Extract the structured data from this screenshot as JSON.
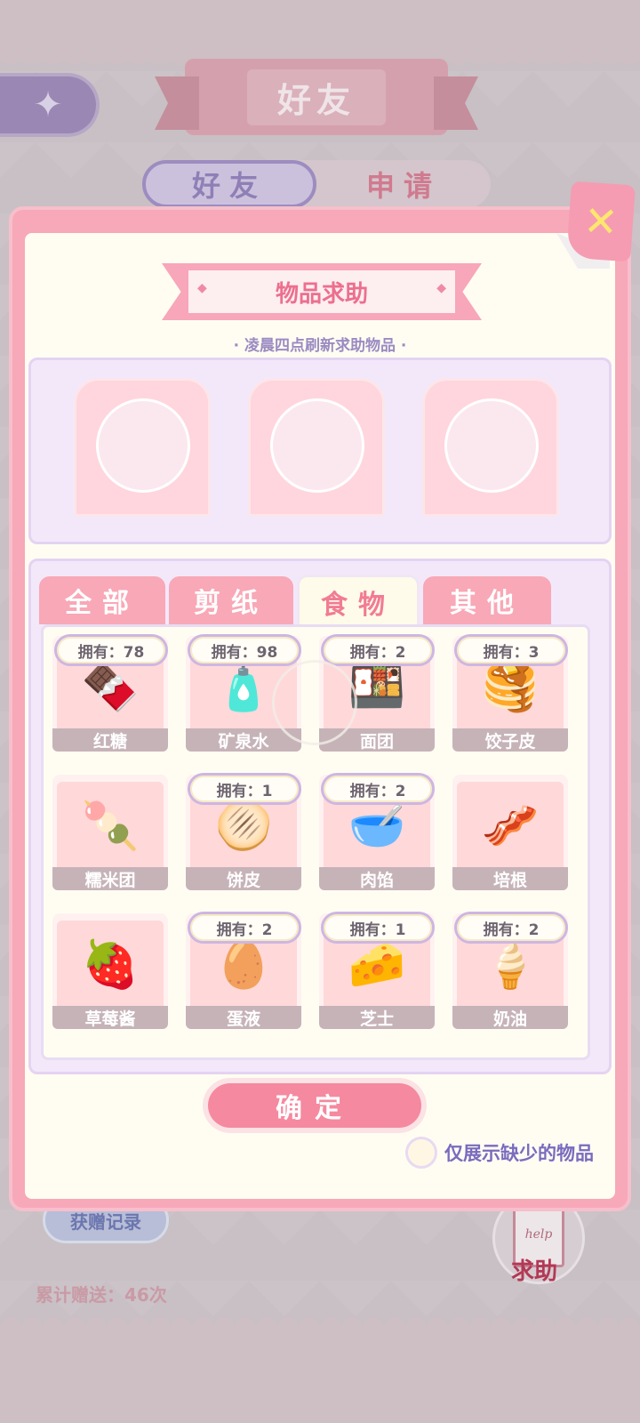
{
  "header": {
    "title": "好友",
    "back_icon": "compass-star-icon"
  },
  "bg_tabs": {
    "friend": "好友",
    "apply": "申请"
  },
  "dialog": {
    "section_title": "物品求助",
    "refresh_hint": "· 凌晨四点刷新求助物品 ·",
    "close_icon": "close-x-icon",
    "tabs": [
      "全部",
      "剪纸",
      "食物",
      "其他"
    ],
    "active_tab": "食物",
    "items": [
      {
        "name": "红糖",
        "owned": "拥有：78",
        "icon": "brown-sugar-bag"
      },
      {
        "name": "矿泉水",
        "owned": "拥有：98",
        "icon": "water-bottle"
      },
      {
        "name": "面团",
        "owned": "拥有：2",
        "icon": "dough-box"
      },
      {
        "name": "饺子皮",
        "owned": "拥有：3",
        "icon": "dumpling-wrappers"
      },
      {
        "name": "糯米团",
        "owned": "",
        "icon": "rice-balls-bowl"
      },
      {
        "name": "饼皮",
        "owned": "拥有：1",
        "icon": "pastry-sheet"
      },
      {
        "name": "肉馅",
        "owned": "拥有：2",
        "icon": "meat-filling-bowl"
      },
      {
        "name": "培根",
        "owned": "",
        "icon": "bacon"
      },
      {
        "name": "草莓酱",
        "owned": "",
        "icon": "strawberry-jam-jar"
      },
      {
        "name": "蛋液",
        "owned": "拥有：2",
        "icon": "egg-mix-bowl"
      },
      {
        "name": "芝士",
        "owned": "拥有：1",
        "icon": "cheese"
      },
      {
        "name": "奶油",
        "owned": "拥有：2",
        "icon": "cream-bowl"
      }
    ],
    "confirm_label": "确定",
    "missing_only_label": "仅展示缺少的物品"
  },
  "footer": {
    "received_records": "获赠记录",
    "total_given": "累计赠送：46次",
    "help_note": "help",
    "help_label": "求助"
  },
  "colors": {
    "accent_pink": "#f5899f",
    "lavender": "#7a6bbe",
    "panel_bg": "#fffdf2"
  }
}
